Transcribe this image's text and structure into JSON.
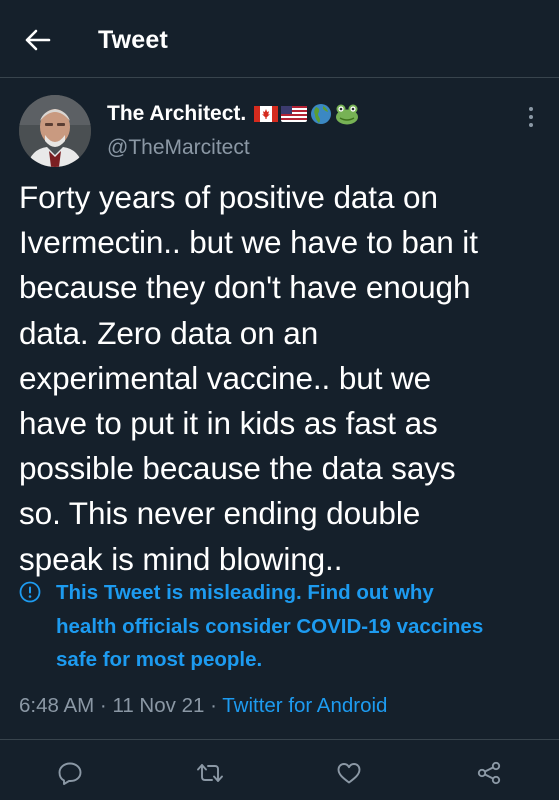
{
  "header": {
    "title": "Tweet"
  },
  "author": {
    "name": "The Architect.",
    "handle": "@TheMarcitect",
    "flags": [
      "flag-canada-icon",
      "flag-usa-icon",
      "globe-americas-icon",
      "frog-icon"
    ]
  },
  "tweet": {
    "text": "Forty years of positive data on\nIvermectin.. but we have to ban it\nbecause they don't have enough\ndata. Zero data on an\nexperimental vaccine.. but we\nhave to put it in kids as fast as\npossible because the data says\nso. This never ending double\nspeak is mind blowing.."
  },
  "notice": {
    "text": "This Tweet is misleading. Find out why\nhealth officials consider COVID-19 vaccines\nsafe for most people.",
    "color": "#1d9bf0"
  },
  "meta": {
    "time": "6:48 AM",
    "date": "11 Nov 21",
    "separator": "·",
    "source": "Twitter for Android"
  },
  "actions": [
    "reply-icon",
    "retweet-icon",
    "like-icon",
    "share-icon"
  ],
  "colors": {
    "background": "#15202b",
    "text": "#ffffff",
    "secondary": "#8b98a5",
    "accent": "#1d9bf0",
    "border": "#38444d"
  }
}
